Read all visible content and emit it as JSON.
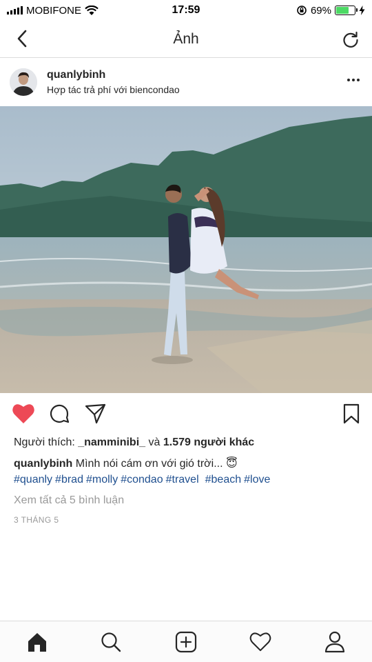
{
  "status_bar": {
    "carrier": "MOBIFONE",
    "time": "17:59",
    "battery_percent": "69%",
    "battery_level": 0.69
  },
  "header": {
    "title": "Ảnh",
    "back_icon": "chevron-left-icon",
    "refresh_icon": "refresh-icon"
  },
  "post": {
    "username": "quanlybinh",
    "sponsor_prefix": "Hợp tác trả phí với ",
    "sponsor_partner": "biencondao",
    "likes_prefix": "Người thích: ",
    "likes_user": "_namminibi_",
    "likes_mid": " và ",
    "likes_others": "1.579 người khác",
    "caption_user": "quanlybinh",
    "caption_text": " Mình nói cám ơn với gió trời... 😇",
    "hashtags": [
      "#quanly",
      "#brad",
      "#molly",
      "#condao",
      "#travel",
      "#beach",
      "#love"
    ],
    "view_comments": "Xem tất cả 5 bình luận",
    "date": "3 THÁNG 5"
  },
  "colors": {
    "heart": "#ed4956",
    "hashtag": "#1f4f8f",
    "muted": "#999999",
    "battery": "#4cd964"
  },
  "tabs": [
    "home-icon",
    "search-icon",
    "add-post-icon",
    "activity-heart-icon",
    "profile-icon"
  ]
}
